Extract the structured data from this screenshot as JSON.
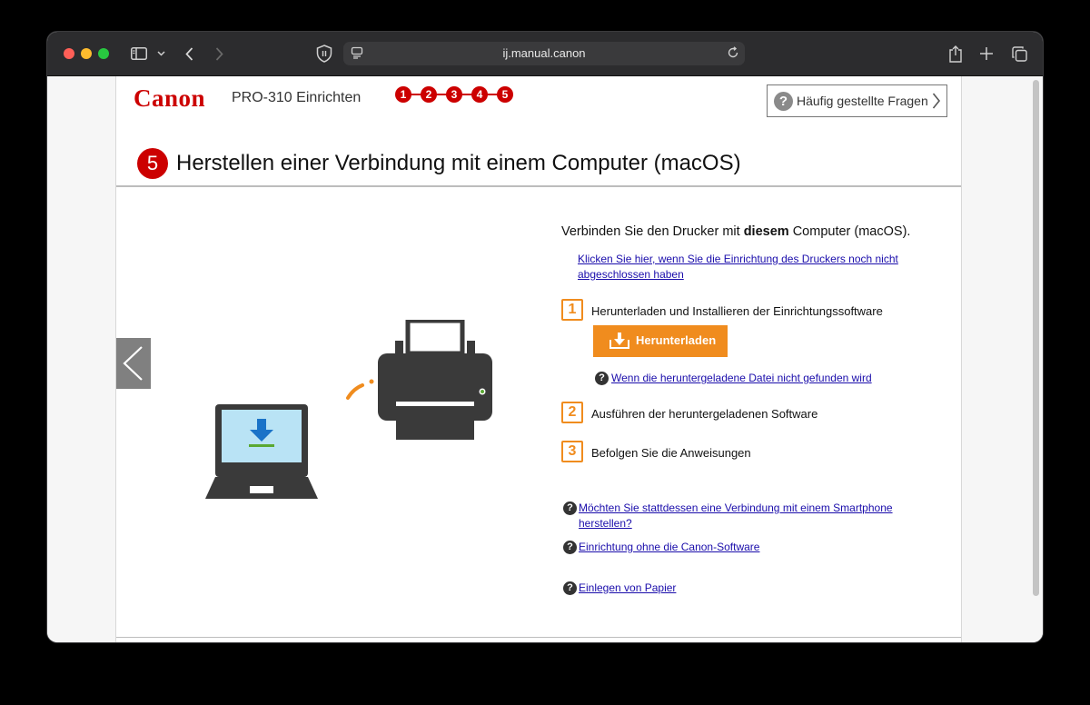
{
  "browser": {
    "url": "ij.manual.canon",
    "icons": [
      "sidebar-icon",
      "chevron-down-icon",
      "back-icon",
      "forward-icon",
      "shield-icon",
      "page-icon",
      "reload-icon",
      "share-icon",
      "plus-icon",
      "tabs-icon"
    ]
  },
  "header": {
    "logo": "Canon",
    "product": "PRO-310 Einrichten",
    "steps": [
      "1",
      "2",
      "3",
      "4",
      "5"
    ],
    "faq_label": "Häufig gestellte Fragen"
  },
  "main": {
    "step_number": "5",
    "title": "Herstellen einer Verbindung mit einem Computer (macOS)",
    "connect_prefix": "Verbinden Sie den Drucker mit ",
    "connect_bold": "diesem",
    "connect_suffix": " Computer (macOS).",
    "setup_link": "Klicken Sie hier, wenn Sie die Einrichtung des Druckers noch nicht abgeschlossen haben",
    "steps": [
      {
        "num": "1",
        "text": "Herunterladen und Installieren der Einrichtungssoftware"
      },
      {
        "num": "2",
        "text": "Ausführen der heruntergeladenen Software"
      },
      {
        "num": "3",
        "text": "Befolgen Sie die Anweisungen"
      }
    ],
    "download_label": "Herunterladen",
    "file_not_found_link": "Wenn die heruntergeladene Datei nicht gefunden wird",
    "smartphone_link": "Möchten Sie stattdessen eine Verbindung mit einem Smartphone herstellen?",
    "no_software_link": "Einrichtung ohne die Canon-Software",
    "paper_link": "Einlegen von Papier"
  },
  "colors": {
    "canon_red": "#cc0000",
    "accent_orange": "#f08c1e",
    "link_blue": "#1a0dab"
  }
}
